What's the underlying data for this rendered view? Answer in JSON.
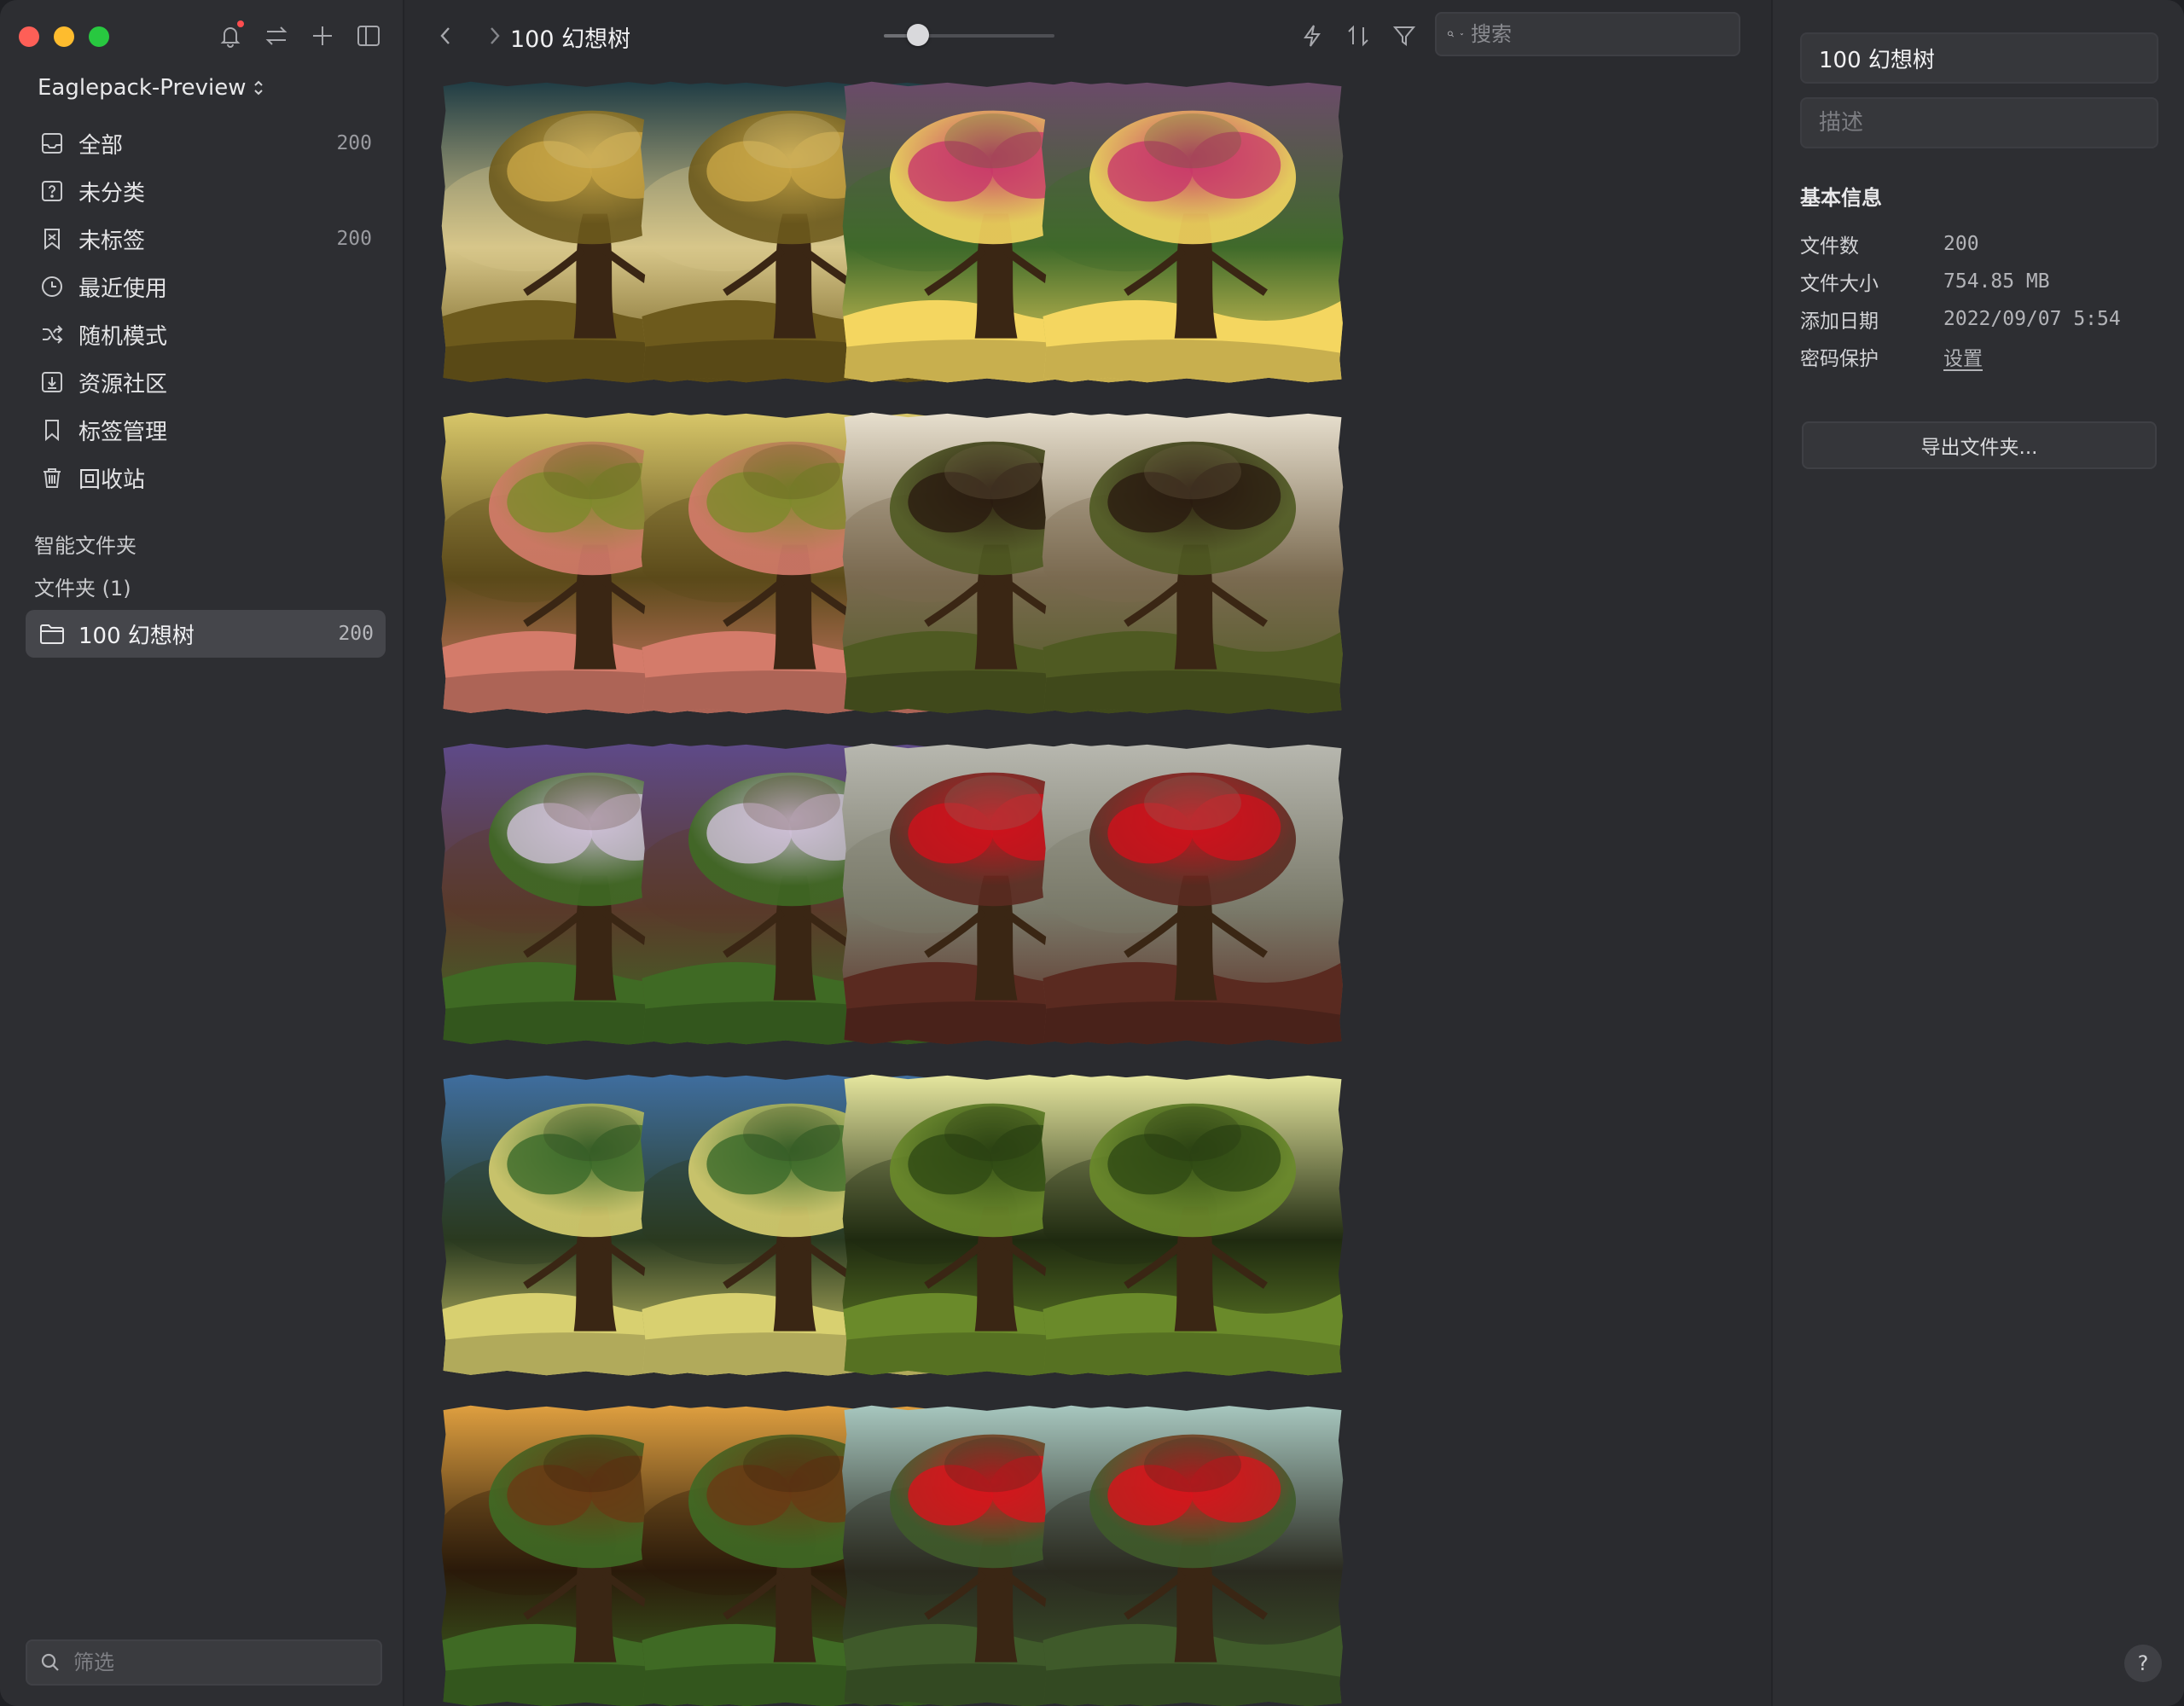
{
  "sidebar": {
    "library_name": "Eaglepack-Preview",
    "nav_items": [
      {
        "label": "全部",
        "icon": "inbox-icon",
        "count": "200"
      },
      {
        "label": "未分类",
        "icon": "question-box-icon",
        "count": ""
      },
      {
        "label": "未标签",
        "icon": "untagged-icon",
        "count": "200"
      },
      {
        "label": "最近使用",
        "icon": "clock-icon",
        "count": ""
      },
      {
        "label": "随机模式",
        "icon": "shuffle-icon",
        "count": ""
      },
      {
        "label": "资源社区",
        "icon": "download-box-icon",
        "count": ""
      },
      {
        "label": "标签管理",
        "icon": "bookmark-icon",
        "count": ""
      },
      {
        "label": "回收站",
        "icon": "trash-icon",
        "count": ""
      }
    ],
    "smart_folders_title": "智能文件夹",
    "folders_title": "文件夹 (1)",
    "folder": {
      "label": "100 幻想树",
      "count": "200"
    },
    "filter_placeholder": "筛选"
  },
  "toolbar": {
    "breadcrumb": "100 幻想树",
    "search_placeholder": "搜索",
    "zoom_level": 0.2
  },
  "grid": {
    "items": [
      {
        "scene": "golden-root-tree",
        "colors": [
          "#1e3b44",
          "#c9a646",
          "#6d5a1c",
          "#d8c78a"
        ]
      },
      {
        "scene": "golden-root-tree",
        "colors": [
          "#1e3b44",
          "#c9a646",
          "#6d5a1c",
          "#d8c78a"
        ]
      },
      {
        "scene": "pink-canopy-sunset",
        "colors": [
          "#6b4a6a",
          "#c8386a",
          "#f4d660",
          "#3f6a2a"
        ]
      },
      {
        "scene": "pink-canopy-sunset",
        "colors": [
          "#6b4a6a",
          "#c8386a",
          "#f4d660",
          "#3f6a2a"
        ]
      },
      {
        "scene": "pink-tree-golden-river",
        "colors": [
          "#d9c86a",
          "#7e8a2c",
          "#d47b6a",
          "#5b4a1a"
        ]
      },
      {
        "scene": "pink-tree-golden-river",
        "colors": [
          "#d9c86a",
          "#7e8a2c",
          "#d47b6a",
          "#5b4a1a"
        ]
      },
      {
        "scene": "dark-twisted-tree",
        "colors": [
          "#e8e0cf",
          "#2a1b10",
          "#4f5a22",
          "#7a6a50"
        ]
      },
      {
        "scene": "dark-twisted-tree",
        "colors": [
          "#e8e0cf",
          "#2a1b10",
          "#4f5a22",
          "#7a6a50"
        ]
      },
      {
        "scene": "purple-sky-tree",
        "colors": [
          "#5e4a8a",
          "#cfc0d8",
          "#3f6a24",
          "#5a3a2a"
        ]
      },
      {
        "scene": "purple-sky-tree",
        "colors": [
          "#5e4a8a",
          "#cfc0d8",
          "#3f6a24",
          "#5a3a2a"
        ]
      },
      {
        "scene": "red-canopy-tree",
        "colors": [
          "#b8b8b0",
          "#d0121c",
          "#5a2a20",
          "#7a7a6a"
        ]
      },
      {
        "scene": "red-canopy-tree",
        "colors": [
          "#b8b8b0",
          "#d0121c",
          "#5a2a20",
          "#7a7a6a"
        ]
      },
      {
        "scene": "glowing-trunk-blue",
        "colors": [
          "#3f6ea0",
          "#3b6a2a",
          "#d8d070",
          "#2a3a20"
        ]
      },
      {
        "scene": "glowing-trunk-blue",
        "colors": [
          "#3f6ea0",
          "#3b6a2a",
          "#d8d070",
          "#2a3a20"
        ]
      },
      {
        "scene": "green-mossy-tree",
        "colors": [
          "#e8e8a0",
          "#2f4a14",
          "#6a8a2a",
          "#1f2a10"
        ]
      },
      {
        "scene": "green-mossy-tree",
        "colors": [
          "#e8e8a0",
          "#2f4a14",
          "#6a8a2a",
          "#1f2a10"
        ]
      },
      {
        "scene": "amber-temple-tree",
        "colors": [
          "#e0a040",
          "#6a3a14",
          "#3f6a24",
          "#2a1a0a"
        ]
      },
      {
        "scene": "amber-temple-tree",
        "colors": [
          "#e0a040",
          "#6a3a14",
          "#3f6a24",
          "#2a1a0a"
        ]
      },
      {
        "scene": "red-tree-cliff",
        "colors": [
          "#a8c8c0",
          "#d8141c",
          "#3f5a2a",
          "#2a2a20"
        ]
      },
      {
        "scene": "red-tree-cliff",
        "colors": [
          "#a8c8c0",
          "#d8141c",
          "#3f5a2a",
          "#2a2a20"
        ]
      }
    ]
  },
  "inspector": {
    "name_value": "100 幻想树",
    "description_placeholder": "描述",
    "section_title": "基本信息",
    "rows": [
      {
        "key": "文件数",
        "value": "200"
      },
      {
        "key": "文件大小",
        "value": "754.85 MB"
      },
      {
        "key": "添加日期",
        "value": "2022/09/07 5:54"
      },
      {
        "key": "密码保护",
        "value": "设置"
      }
    ],
    "export_label": "导出文件夹...",
    "help_label": "?"
  },
  "colors": {
    "sidebar_bg": "#2d2e32",
    "main_bg": "#2a2b2f",
    "selected_row": "#45464b",
    "notification_dot": "#ff4d4f"
  }
}
